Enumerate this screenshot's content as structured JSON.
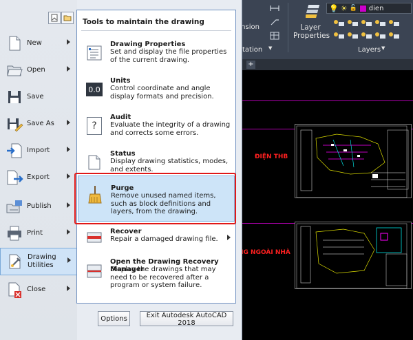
{
  "ribbon": {
    "dimension_label": "ension",
    "annotation_label": "tation",
    "layer_properties_label_1": "Layer",
    "layer_properties_label_2": "Properties",
    "layers_label": "Layers",
    "layer_name": "dien"
  },
  "left_menu": {
    "items": [
      {
        "label": "New",
        "icon": "new-file-icon",
        "has_submenu": true
      },
      {
        "label": "Open",
        "icon": "open-folder-icon",
        "has_submenu": true
      },
      {
        "label": "Save",
        "icon": "save-icon",
        "has_submenu": false
      },
      {
        "label": "Save As",
        "icon": "save-as-icon",
        "has_submenu": true
      },
      {
        "label": "Import",
        "icon": "import-icon",
        "has_submenu": true
      },
      {
        "label": "Export",
        "icon": "export-icon",
        "has_submenu": true
      },
      {
        "label": "Publish",
        "icon": "publish-icon",
        "has_submenu": true
      },
      {
        "label": "Print",
        "icon": "printer-icon",
        "has_submenu": true
      },
      {
        "label_1": "Drawing",
        "label_2": "Utilities",
        "icon": "drawing-utilities-icon",
        "has_submenu": true,
        "selected": true
      },
      {
        "label": "Close",
        "icon": "close-file-icon",
        "has_submenu": true
      }
    ]
  },
  "right_panel": {
    "header": "Tools to maintain the drawing",
    "items": [
      {
        "title": "Drawing Properties",
        "description": "Set and display the file properties of the current drawing.",
        "icon": "drawing-properties-icon"
      },
      {
        "title": "Units",
        "description": "Control coordinate and angle display formats and precision.",
        "icon": "units-icon",
        "icon_text": "0.0"
      },
      {
        "title": "Audit",
        "description": "Evaluate the integrity of a drawing and corrects some errors.",
        "icon": "audit-icon",
        "icon_text": "?"
      },
      {
        "title": "Status",
        "description": "Display drawing statistics, modes, and extents.",
        "icon": "status-icon"
      },
      {
        "title": "Purge",
        "description": "Remove unused named items, such as block definitions and layers, from the drawing.",
        "icon": "purge-broom-icon",
        "highlighted": true
      },
      {
        "title": "Recover",
        "description": "Repair a damaged drawing file.",
        "icon": "recover-icon",
        "has_submenu": true
      },
      {
        "title": "Open the Drawing Recovery Manager",
        "description": "Display the drawings that may need to be recovered after a program or system failure.",
        "icon": "recovery-manager-icon"
      }
    ]
  },
  "footer": {
    "options_label": "Options",
    "exit_label": "Exit Autodesk AutoCAD 2018"
  },
  "canvas": {
    "label_1": "ĐIỆN THB",
    "label_2": "NG NGOÀI NHÀ"
  },
  "colors": {
    "accent": "#cfe3f7",
    "highlight_border": "#e01818",
    "layer_color": "#cc00cc"
  }
}
